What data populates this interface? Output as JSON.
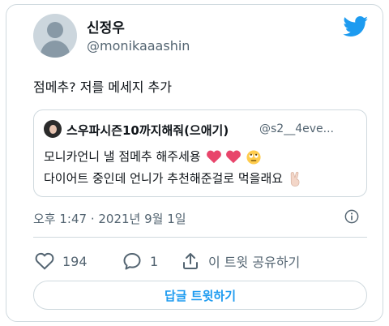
{
  "author": {
    "name": "신정우",
    "handle": "@monikaaashin"
  },
  "tweet": {
    "text": "점메추? 저를 메세지 추가"
  },
  "quoted_tweet": {
    "name": "스우파시즌10까지해줘(으애기)",
    "handle": "@s2__4eve...",
    "line1": "모니카언니 낼 점메추 해주세용",
    "line2": "다이어트 중인데 언니가 추천해준걸로 먹을래요"
  },
  "meta": {
    "timestamp": "오후 1:47 · 2021년 9월 1일"
  },
  "actions": {
    "likes": "194",
    "replies": "1",
    "share_label": "이 트윗 공유하기"
  },
  "reply_button": {
    "label": "답글 트윗하기"
  },
  "colors": {
    "accent": "#1d9bf0",
    "text": "#0f1419",
    "muted": "#536471",
    "border": "#cfd9de",
    "heart_emoji": "#e8456b"
  },
  "icons": [
    "twitter-bird-icon",
    "info-icon",
    "heart-outline-icon",
    "reply-bubble-icon",
    "share-icon",
    "heart-emoji-icon",
    "rolling-eyes-emoji-icon",
    "victory-hand-emoji-icon"
  ]
}
